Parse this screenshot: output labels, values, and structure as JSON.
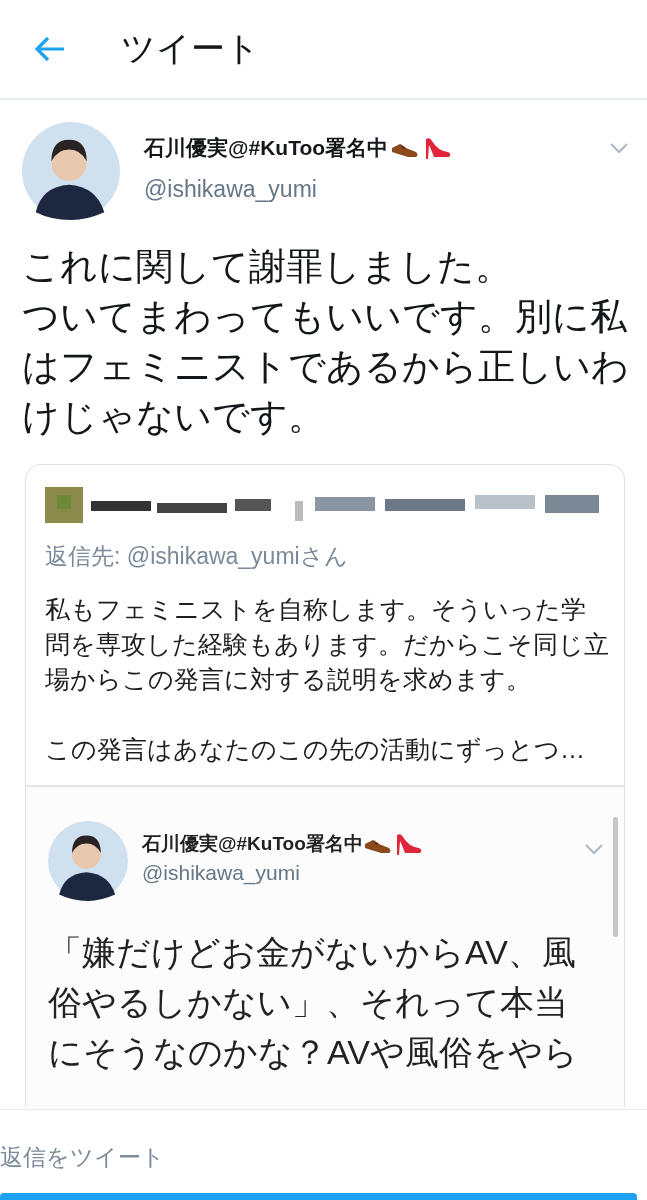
{
  "header": {
    "title": "ツイート"
  },
  "tweet": {
    "author_name": "石川優実@#KuToo署名中",
    "handle": "@ishikawa_yumi",
    "paragraphs": [
      "これに関して謝罪しました。",
      "ついてまわってもいいです。別に私はフェミニストであるから正しいわけじゃないです。"
    ]
  },
  "quoted_tweet": {
    "reply_to": "返信先: @ishikawa_yumiさん",
    "paragraphs": [
      "私もフェミニストを自称します。そういった学問を専攻した経験もあります。だからこそ同じ立場からこの発言に対する説明を求めます。",
      "この発言はあなたのこの先の活動にずっとつ…"
    ],
    "screenshot": {
      "author_name": "石川優実@#KuToo署名中",
      "handle": "@ishikawa_yumi",
      "text_lines": [
        "「嫌だけどお金がないからAV、風",
        "俗やるしかない」、それって本当",
        "にそうなのかな？AVや風俗をやら"
      ]
    }
  },
  "reply_bar": {
    "placeholder": "返信をツイート"
  }
}
